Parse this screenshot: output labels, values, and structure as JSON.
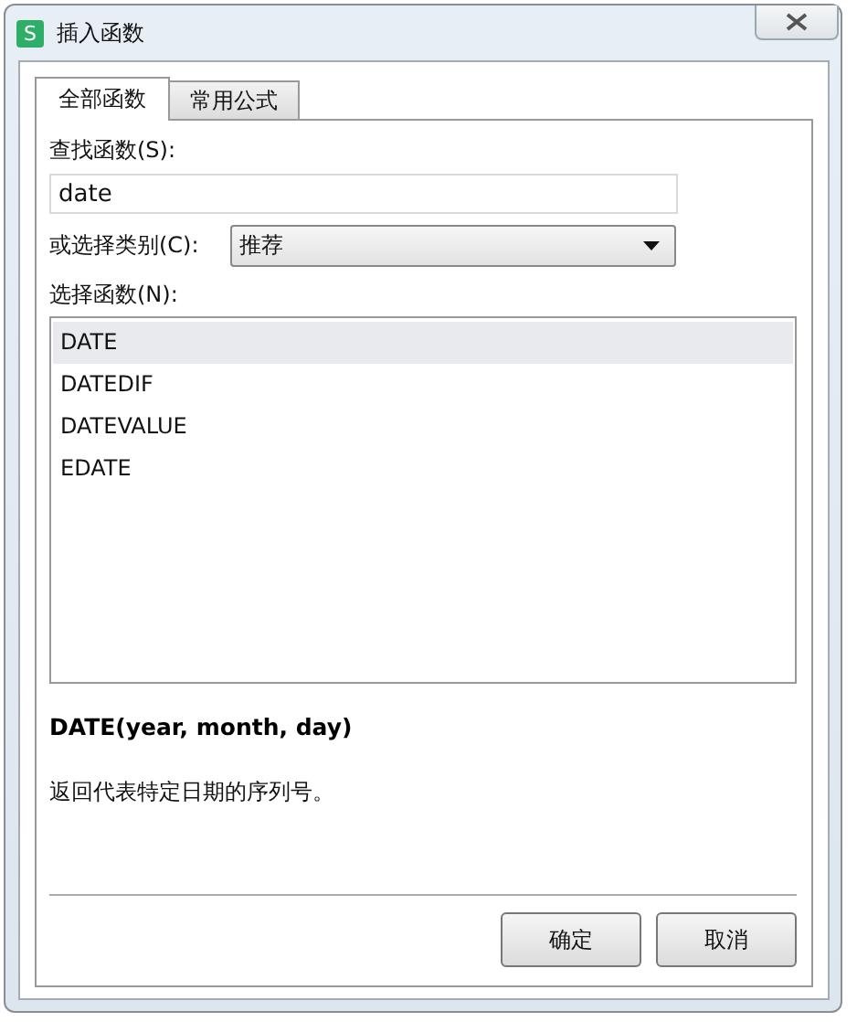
{
  "window": {
    "title": "插入函数",
    "icon_letter": "S"
  },
  "tabs": [
    {
      "label": "全部函数",
      "selected": true
    },
    {
      "label": "常用公式",
      "selected": false
    }
  ],
  "search": {
    "label": "查找函数(S):",
    "value": "date"
  },
  "category": {
    "label": "或选择类别(C):",
    "value": "推荐"
  },
  "functions": {
    "label": "选择函数(N):",
    "items": [
      {
        "name": "DATE",
        "selected": true
      },
      {
        "name": "DATEDIF",
        "selected": false
      },
      {
        "name": "DATEVALUE",
        "selected": false
      },
      {
        "name": "EDATE",
        "selected": false
      }
    ]
  },
  "signature": "DATE(year, month, day)",
  "description": "返回代表特定日期的序列号。",
  "buttons": [
    "确定",
    "取消"
  ]
}
